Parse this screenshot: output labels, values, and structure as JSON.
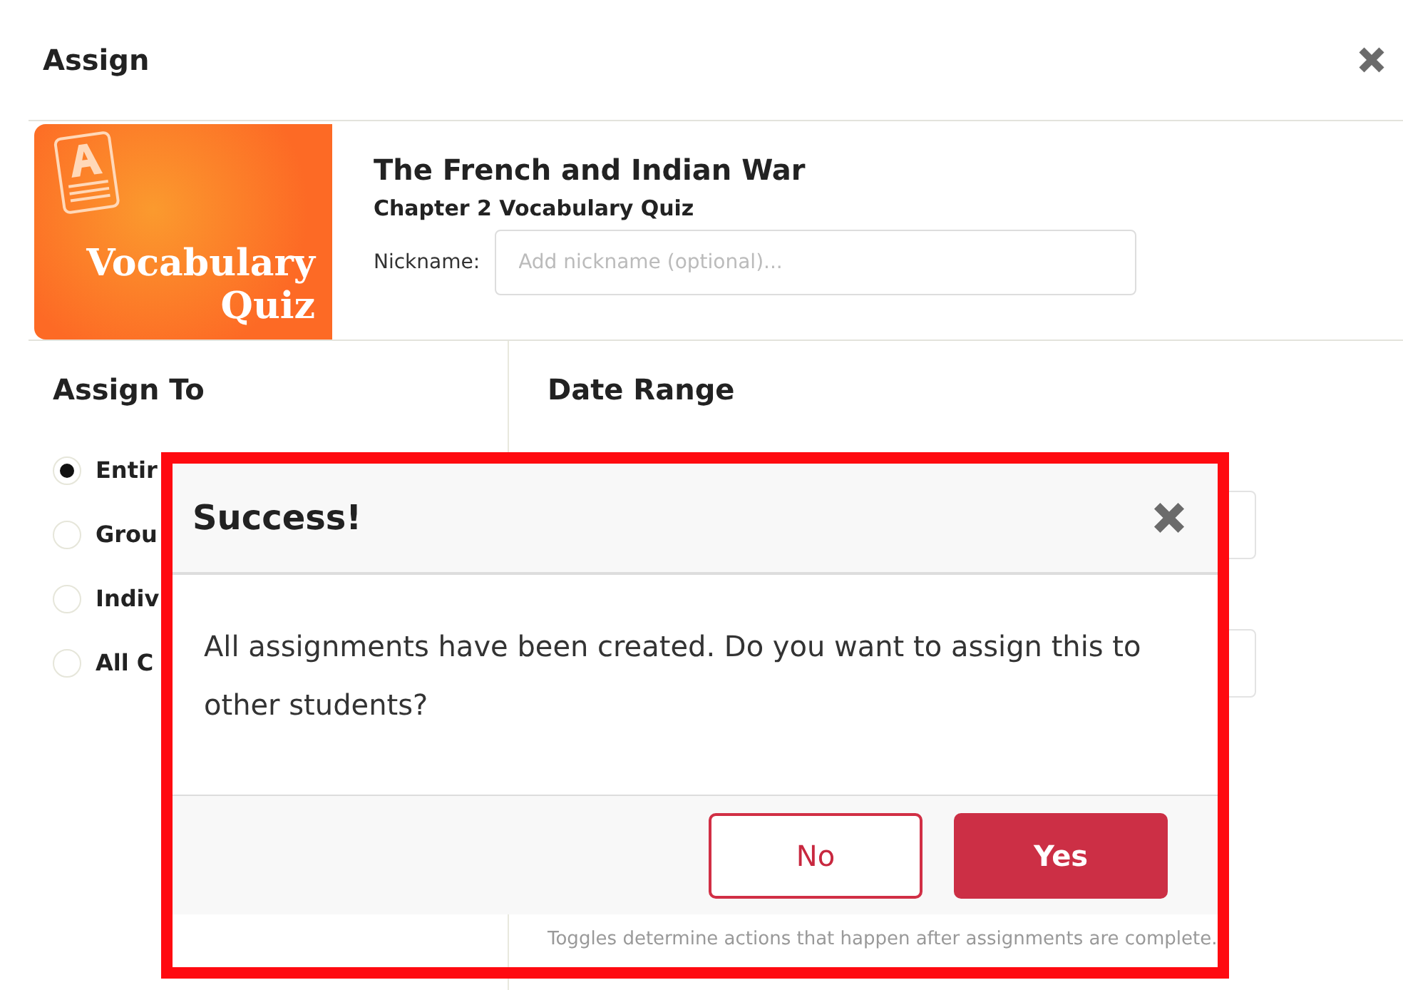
{
  "window": {
    "title": "Assign"
  },
  "assignment": {
    "tile_lines": [
      "Vocabulary",
      "Quiz"
    ],
    "title": "The French and Indian War",
    "subtitle": "Chapter 2 Vocabulary Quiz",
    "nickname_label": "Nickname:",
    "nickname_placeholder": "Add nickname (optional)..."
  },
  "assign_to": {
    "heading": "Assign To",
    "options": [
      {
        "label": "Entir",
        "selected": true
      },
      {
        "label": "Grou",
        "selected": false
      },
      {
        "label": "Indiv",
        "selected": false
      },
      {
        "label": "All C",
        "selected": false
      }
    ]
  },
  "date_range": {
    "heading": "Date Range",
    "note": "Toggles determine actions that happen after assignments are complete."
  },
  "dialog": {
    "title": "Success!",
    "message": "All assignments have been created. Do you want to assign this to other students?",
    "buttons": [
      {
        "label": "No",
        "kind": "secondary"
      },
      {
        "label": "Yes",
        "kind": "primary"
      }
    ]
  }
}
